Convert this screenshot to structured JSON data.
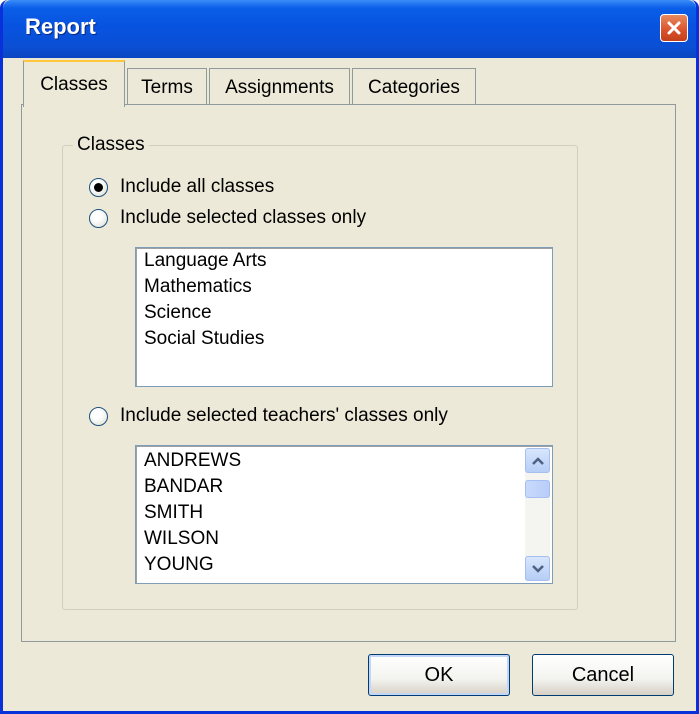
{
  "window": {
    "title": "Report"
  },
  "tabs": [
    {
      "label": "Classes",
      "active": true
    },
    {
      "label": "Terms",
      "active": false
    },
    {
      "label": "Assignments",
      "active": false
    },
    {
      "label": "Categories",
      "active": false
    }
  ],
  "group": {
    "legend": "Classes"
  },
  "options": [
    {
      "label": "Include all classes",
      "checked": true
    },
    {
      "label": "Include selected classes only",
      "checked": false
    },
    {
      "label": "Include selected teachers' classes only",
      "checked": false
    }
  ],
  "classes_list": [
    "Language Arts",
    "Mathematics",
    "Science",
    "Social Studies"
  ],
  "teachers_list": [
    "ANDREWS",
    "BANDAR",
    "SMITH",
    "WILSON",
    "YOUNG"
  ],
  "buttons": {
    "ok": "OK",
    "cancel": "Cancel"
  },
  "icons": {
    "close": "close-icon",
    "scroll_up": "chevron-up-icon",
    "scroll_down": "chevron-down-icon"
  },
  "colors": {
    "titlebar": "#0753e0",
    "face": "#ece9d8",
    "active_tab_accent": "#ffc83c",
    "close_button": "#d9512c"
  }
}
